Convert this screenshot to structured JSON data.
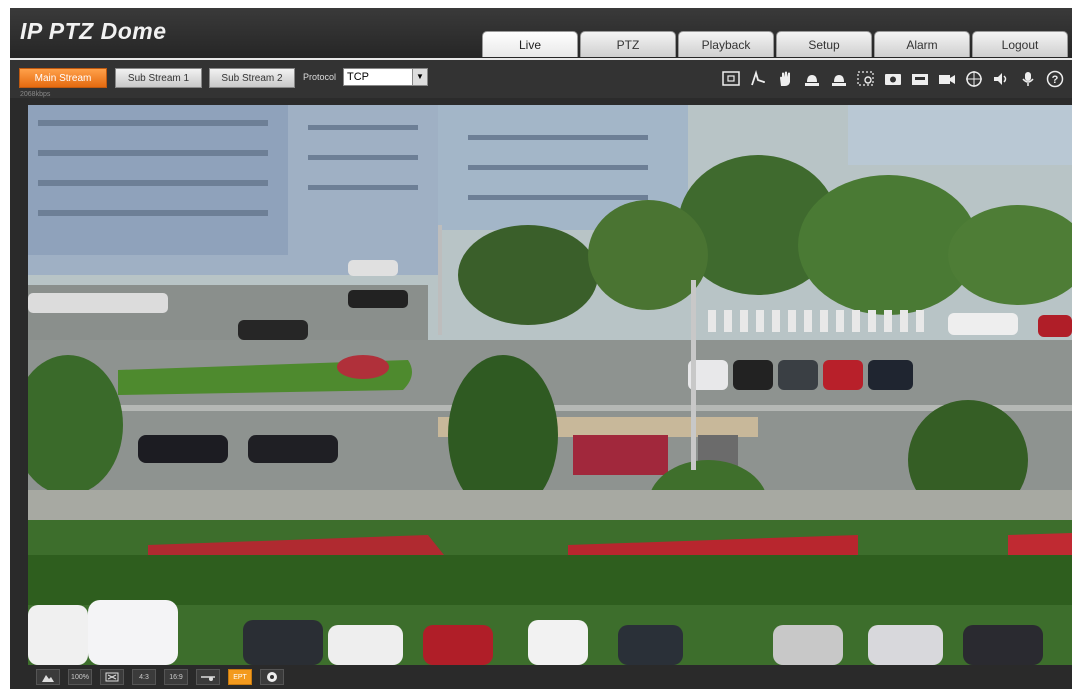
{
  "header": {
    "title": "IP PTZ Dome",
    "tabs": [
      {
        "label": "Live",
        "active": true
      },
      {
        "label": "PTZ",
        "active": false
      },
      {
        "label": "Playback",
        "active": false
      },
      {
        "label": "Setup",
        "active": false
      },
      {
        "label": "Alarm",
        "active": false
      },
      {
        "label": "Logout",
        "active": false
      }
    ]
  },
  "toolbar": {
    "main_stream": "Main Stream",
    "sub_stream_1": "Sub Stream 1",
    "sub_stream_2": "Sub Stream 2",
    "protocol_label": "Protocol",
    "protocol_value": "TCP",
    "bitrate": "2068kbps",
    "icons": [
      "fullscreen-icon",
      "zoom-icon",
      "hand-icon",
      "alarm-light-icon",
      "alarm-light-2-icon",
      "region-zoom-icon",
      "snapshot-icon",
      "record-icon",
      "video-camera-icon",
      "crosshair-icon",
      "speaker-icon",
      "microphone-icon",
      "help-icon"
    ]
  },
  "bottom_bar": {
    "items": [
      "image-adjust-icon",
      "100%",
      "fit-icon",
      "4:3",
      "16:9",
      "rule-icon",
      "EPT",
      "compass-icon"
    ]
  },
  "colors": {
    "accent": "#f07a1a",
    "header_bg": "#2b2b2b"
  }
}
